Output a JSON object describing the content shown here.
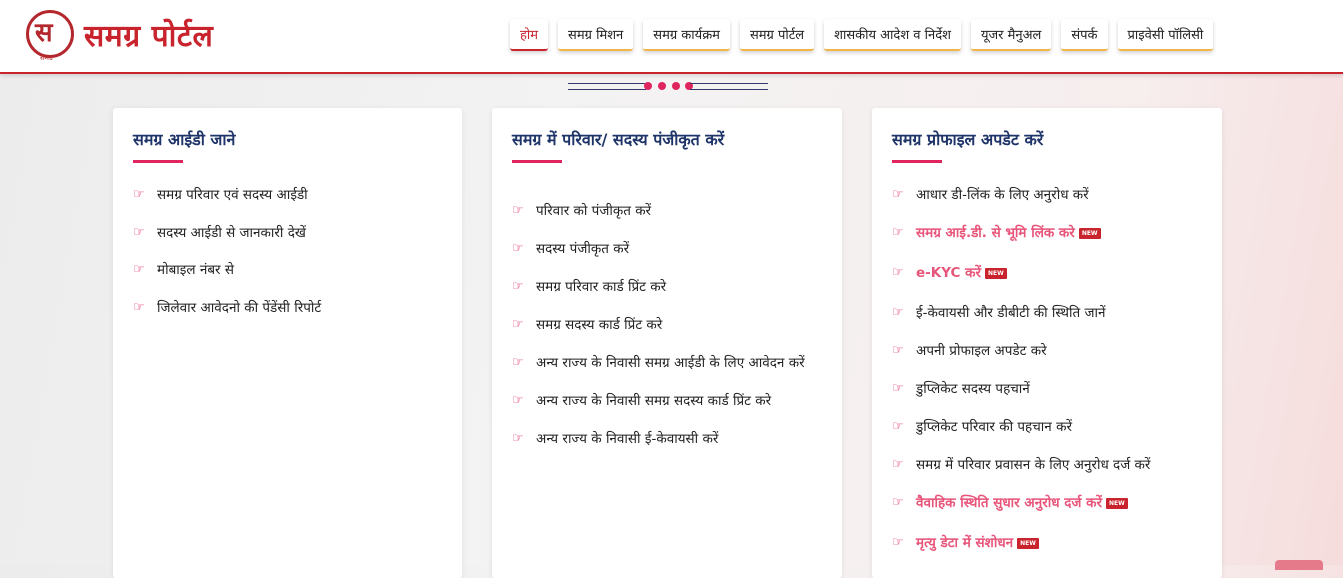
{
  "header": {
    "logo_glyph": "स",
    "logo_sub": "समग्र",
    "title": "समग्र पोर्टल",
    "nav": [
      {
        "label": "होम",
        "active": true
      },
      {
        "label": "समग्र मिशन"
      },
      {
        "label": "समग्र कार्यक्रम"
      },
      {
        "label": "समग्र पोर्टल"
      },
      {
        "label": "शासकीय आदेश व निर्देश"
      },
      {
        "label": "यूजर मैनुअल"
      },
      {
        "label": "संपर्क"
      },
      {
        "label": "प्राइवेसी पॉलिसी"
      }
    ]
  },
  "icons": {
    "list_bullet": "hand-pointing-right-icon"
  },
  "colors": {
    "accent": "#c9242d",
    "pink": "#e0245e",
    "title_blue": "#1f3569"
  },
  "cards": [
    {
      "title": "समग्र आईडी जाने",
      "items": [
        {
          "label": "समग्र परिवार एवं सदस्य आईडी"
        },
        {
          "label": "सदस्य आईडी से जानकारी देखें"
        },
        {
          "label": "मोबाइल नंबर से"
        },
        {
          "label": "जिलेवार आवेदनो की पेंडेंसी रिपोर्ट"
        }
      ]
    },
    {
      "title": "समग्र में परिवार/ सदस्य पंजीकृत करें",
      "items": [
        {
          "label": "परिवार को पंजीकृत करें"
        },
        {
          "label": "सदस्य पंजीकृत करें"
        },
        {
          "label": "समग्र परिवार कार्ड प्रिंट करे"
        },
        {
          "label": "समग्र सदस्य कार्ड प्रिंट करे"
        },
        {
          "label": "अन्य राज्य के निवासी समग्र आईडी के लिए आवेदन करें"
        },
        {
          "label": "अन्य राज्य के निवासी समग्र सदस्य कार्ड प्रिंट करे"
        },
        {
          "label": "अन्य राज्य के निवासी ई-केवायसी करें"
        }
      ]
    },
    {
      "title": "समग्र प्रोफाइल अपडेट करें",
      "items": [
        {
          "label": "आधार डी-लिंक के लिए अनुरोध करें"
        },
        {
          "label": "समग्र आई.डी. से भूमि लिंक करे",
          "new": "NEW"
        },
        {
          "label": "e-KYC करें",
          "new": "NEW"
        },
        {
          "label": "ई-केवायसी और डीबीटी की स्थिति जानें"
        },
        {
          "label": "अपनी प्रोफाइल अपडेट करे"
        },
        {
          "label": "डुप्लिकेट सदस्य पहचानें"
        },
        {
          "label": "डुप्लिकेट परिवार की पहचान करें"
        },
        {
          "label": "समग्र में परिवार प्रवासन के लिए अनुरोध दर्ज करें"
        },
        {
          "label": "वैवाहिक स्थिति सुधार अनुरोध दर्ज करें",
          "new": "NEW"
        },
        {
          "label": "मृत्यु डेटा में संशोधन",
          "new": "NEW"
        }
      ]
    }
  ]
}
